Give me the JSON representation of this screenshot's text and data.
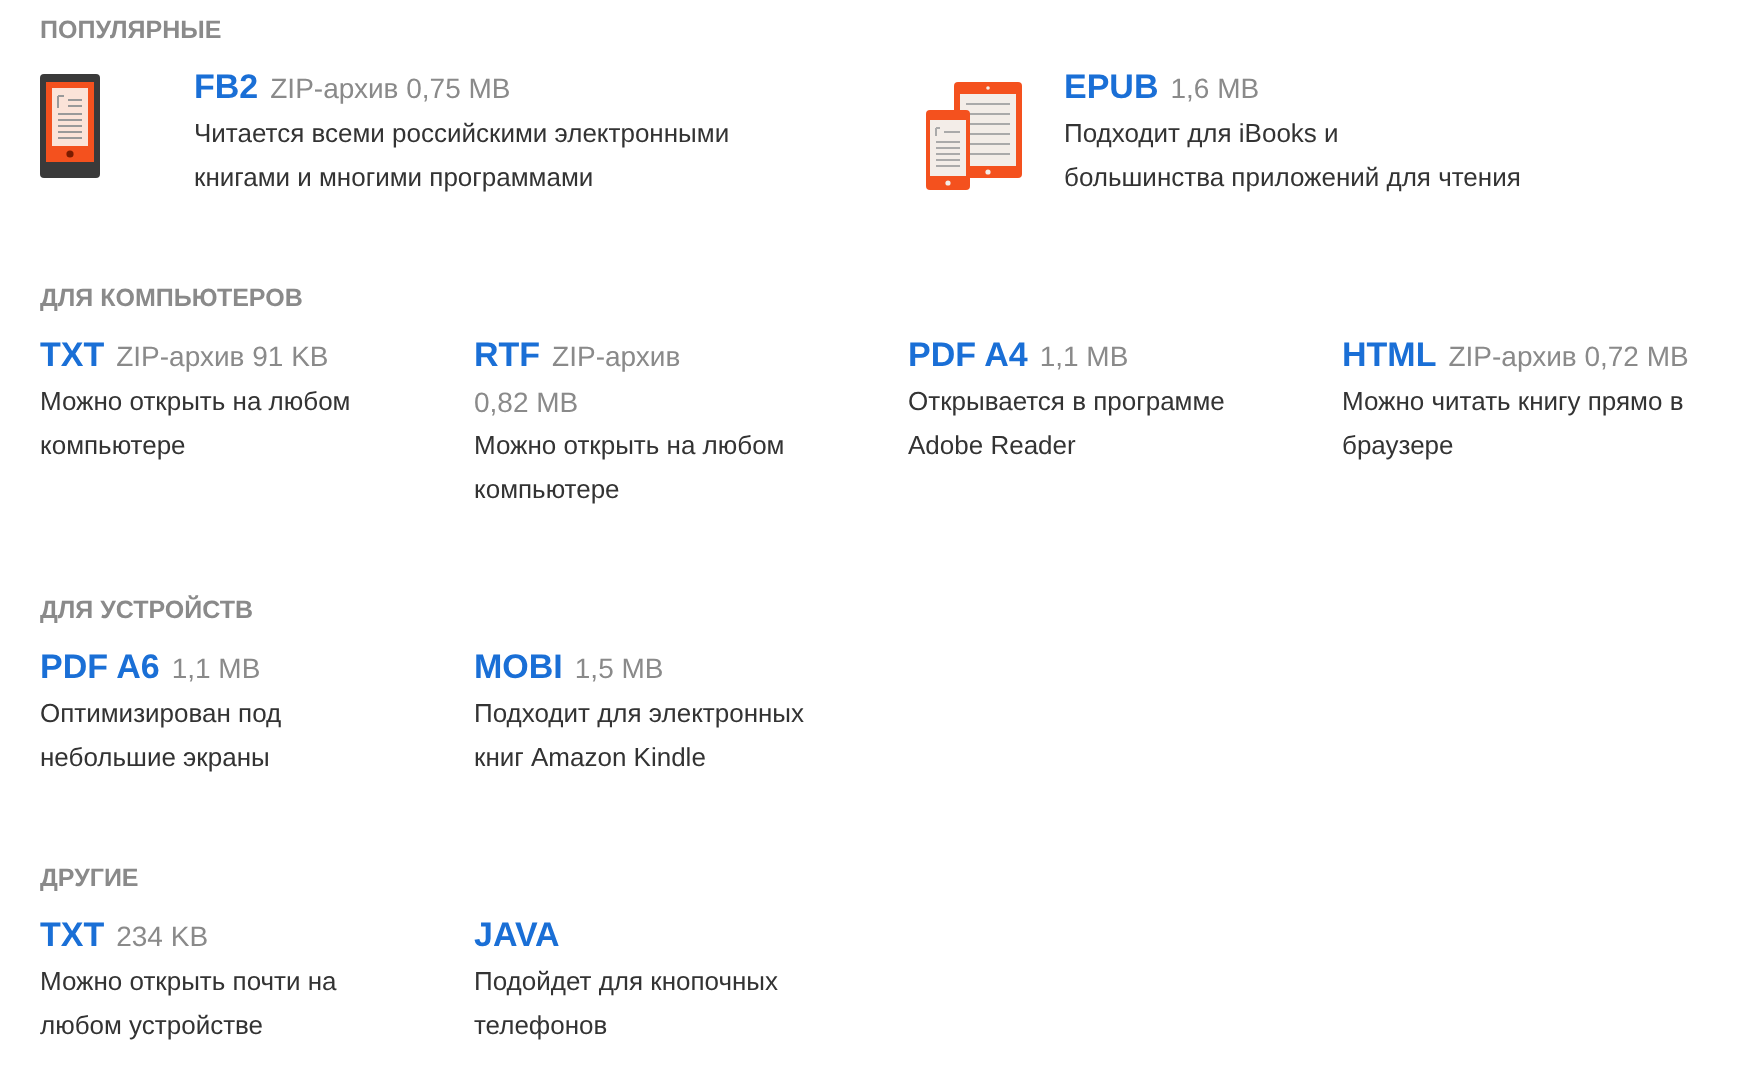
{
  "sections": [
    {
      "title": "ПОПУЛЯРНЫЕ",
      "items": [
        {
          "kind": "reader",
          "format": "FB2",
          "size": [
            "ZIP-архив 0,75 MB"
          ],
          "description": [
            "Читается всеми российскими электронными",
            "книгами и многими программами"
          ]
        },
        {
          "kind": "devices",
          "format": "EPUB",
          "size": [
            "1,6 MB"
          ],
          "description": [
            "Подходит для iBooks и",
            "большинства приложений для чтения"
          ]
        }
      ]
    },
    {
      "title": "ДЛЯ КОМПЬЮТЕРОВ",
      "items": [
        {
          "format": "TXT",
          "size": [
            "ZIP-архив 91 KB"
          ],
          "description": [
            "Можно открыть на любом",
            "компьютере"
          ]
        },
        {
          "format": "RTF",
          "size": [
            "ZIP-архив",
            "0,82 MB"
          ],
          "description": [
            "Можно открыть на любом",
            "компьютере"
          ]
        },
        {
          "format": "PDF A4",
          "size": [
            "1,1 MB"
          ],
          "description": [
            "Открывается в программе",
            "Adobe Reader"
          ]
        },
        {
          "format": "HTML",
          "size": [
            "ZIP-архив 0,72 MB"
          ],
          "description": [
            "Можно читать книгу прямо в",
            "браузере"
          ]
        }
      ]
    },
    {
      "title": "ДЛЯ УСТРОЙСТВ",
      "items": [
        {
          "format": "PDF A6",
          "size": [
            "1,1 MB"
          ],
          "description": [
            "Оптимизирован под",
            "небольшие экраны"
          ]
        },
        {
          "format": "MOBI",
          "size": [
            "1,5 MB"
          ],
          "description": [
            "Подходит для электронных",
            "книг Amazon Kindle"
          ]
        }
      ]
    },
    {
      "title": "ДРУГИЕ",
      "items": [
        {
          "format": "TXT",
          "size": [
            "234 KB"
          ],
          "description": [
            "Можно открыть почти на",
            "любом устройстве"
          ]
        },
        {
          "format": "JAVA",
          "description": [
            "Подойдет для кнопочных",
            "телефонов"
          ]
        }
      ]
    }
  ]
}
